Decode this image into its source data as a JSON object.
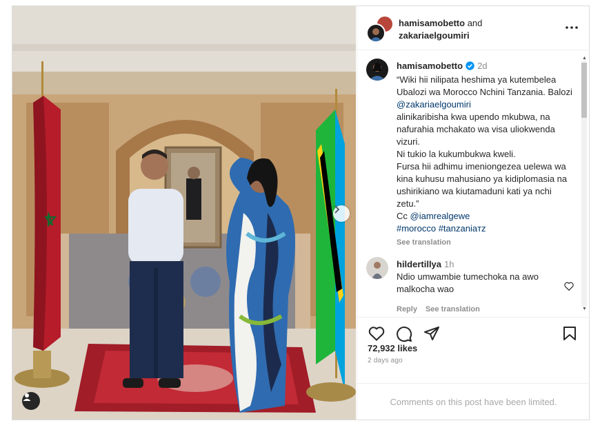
{
  "header": {
    "user1": "hamisamobetto",
    "and_text": "and",
    "user2": "zakariaelgoumiri"
  },
  "caption": {
    "username": "hamisamobetto",
    "time": "2d",
    "text_part1": "“Wiki hii nilipata heshima ya kutembelea Ubalozi wa Morocco Nchini Tanzania. Balozi ",
    "mention": "@zakariaelgoumiri",
    "text_part2": "\nalinikaribisha kwa upendo mkubwa, na nafurahia mchakato wa visa uliokwenda vizuri.\nNi tukio la kukumbukwa kweli.\nFursa hii adhimu imeniongezea uelewa wa kina kuhusu mahusiano ya kidiplomasia na ushirikiano wa kiutamaduni kati ya nchi zetu.”\nCc ",
    "cc_mention": "@iamrealgewe",
    "hashtags": "#morocco #tanzaniaтz",
    "see_translation": "See translation"
  },
  "comment": {
    "username": "hildertillya",
    "time": "1h",
    "text": "Ndio umwambie tumechoka na awo malkocha wao",
    "reply": "Reply",
    "see_translation": "See translation"
  },
  "likes": "72,932 likes",
  "date": "2 days ago",
  "limited_text": "Comments on this post have been limited.",
  "colors": {
    "link": "#00376b",
    "verified": "#0095f6",
    "muted": "#8e8e8e"
  },
  "icons": {
    "more": "more-horizontal-icon",
    "like": "heart-icon",
    "comment": "comment-icon",
    "share": "share-icon",
    "save": "bookmark-icon",
    "tag": "user-tag-icon",
    "next": "chevron-right-icon"
  }
}
